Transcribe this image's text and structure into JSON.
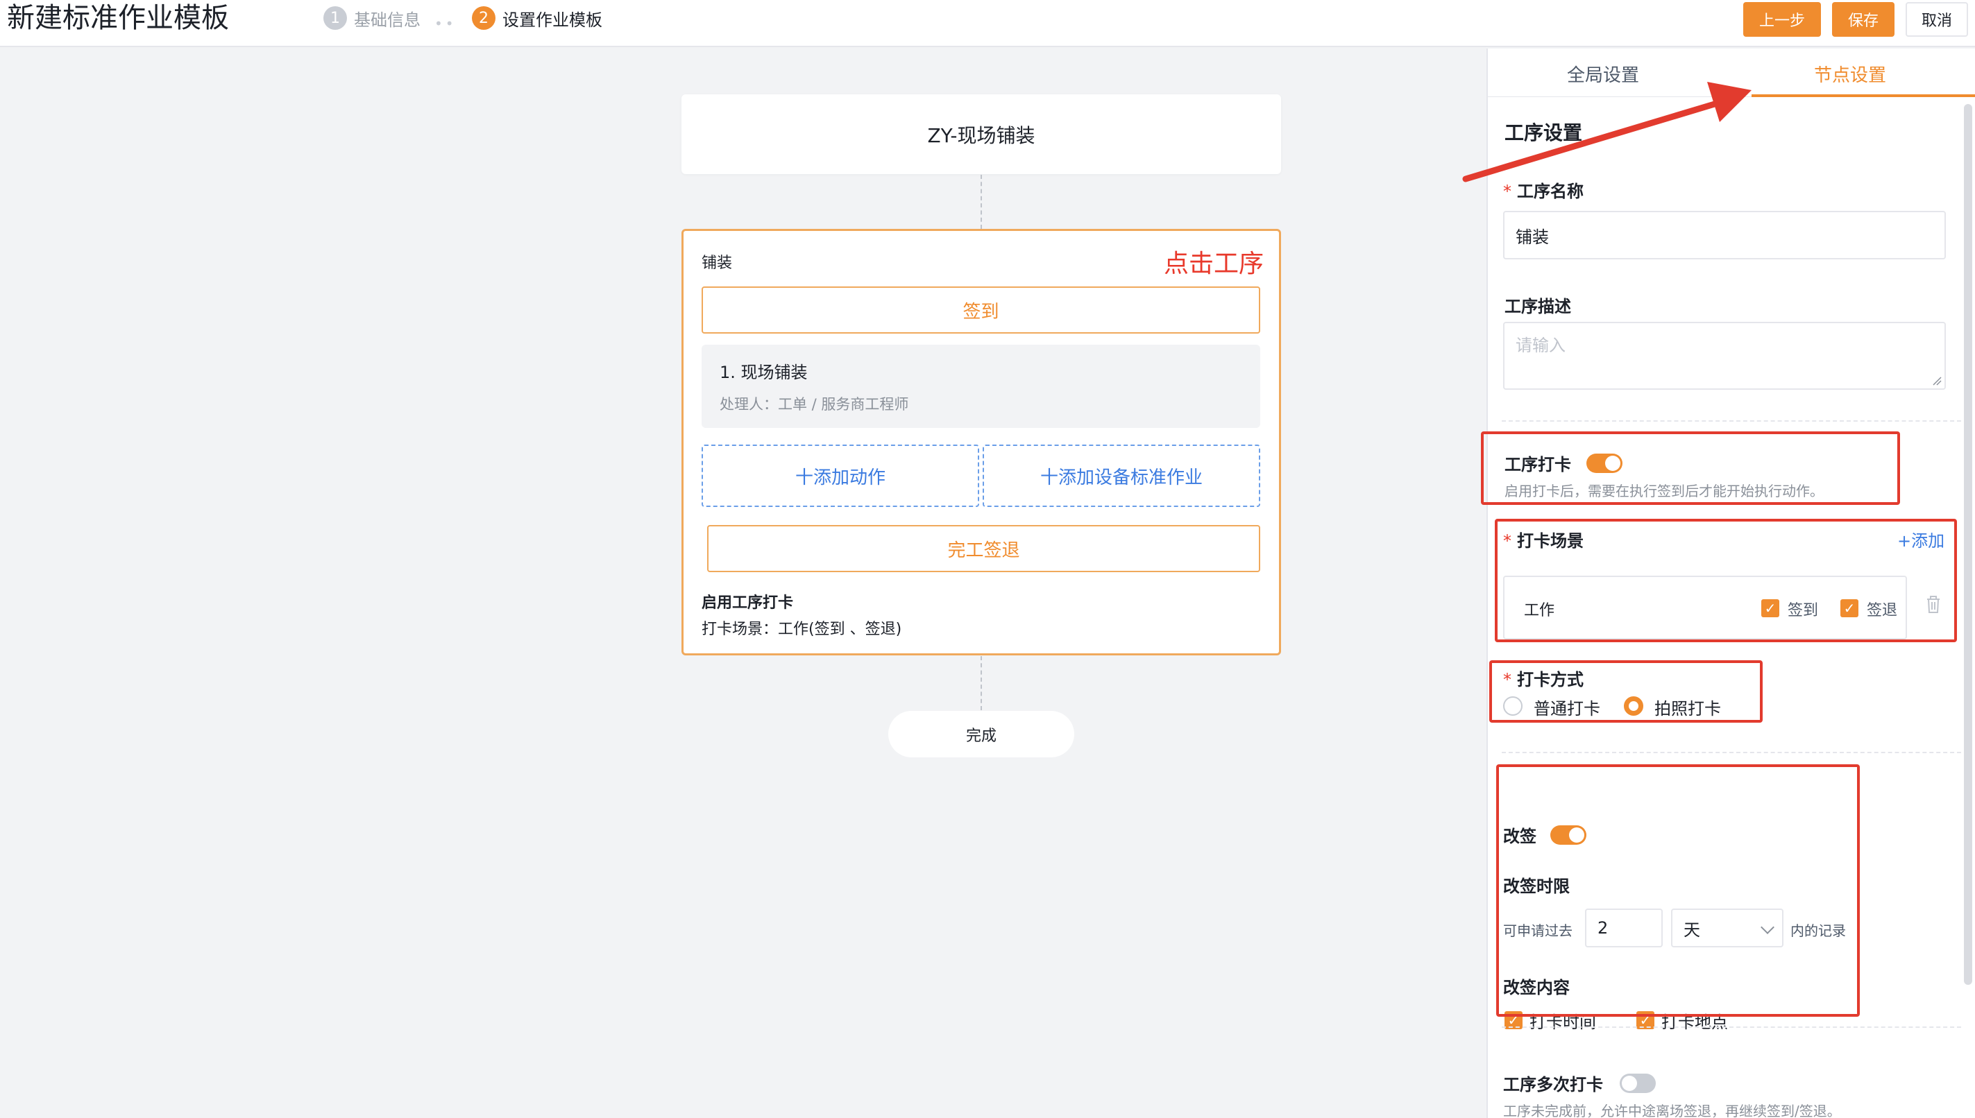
{
  "header": {
    "title": "新建标准作业模板",
    "steps": [
      {
        "num": "1",
        "label": "基础信息"
      },
      {
        "num": "2",
        "label": "设置作业模板"
      }
    ],
    "buttons": {
      "prev": "上一步",
      "save": "保存",
      "cancel": "取消"
    }
  },
  "canvas": {
    "top_node": "ZY-现场铺装",
    "process_node": {
      "label": "铺装",
      "hint": "点击工序",
      "checkin_button": "签到",
      "action": {
        "title": "1. 现场铺装",
        "handler": "处理人：工单 / 服务商工程师"
      },
      "add_action": "十添加动作",
      "add_device": "十添加设备标准作业",
      "checkout_button": "完工签退",
      "footer_title": "启用工序打卡",
      "footer_scene": "打卡场景：工作(签到 、签退)"
    },
    "end_node": "完成"
  },
  "panel": {
    "tabs": {
      "global": "全局设置",
      "node": "节点设置"
    },
    "section_title": "工序设置",
    "name_field": {
      "label": "工序名称",
      "value": "铺装"
    },
    "desc_field": {
      "label": "工序描述",
      "placeholder": "请输入"
    },
    "process_checkin": {
      "label": "工序打卡",
      "enabled": true,
      "hint": "启用打卡后，需要在执行签到后才能开始执行动作。"
    },
    "checkin_scene": {
      "label": "打卡场景",
      "add": "+添加",
      "row": {
        "name": "工作",
        "checkin": "签到",
        "checkout": "签退"
      }
    },
    "checkin_method": {
      "label": "打卡方式",
      "options": [
        "普通打卡",
        "拍照打卡"
      ],
      "selected": "拍照打卡"
    },
    "resign": {
      "label": "改签",
      "enabled": true,
      "limit_label": "改签时限",
      "limit_prefix": "可申请过去",
      "limit_value": "2",
      "limit_unit": "天",
      "limit_suffix": "内的记录",
      "content_label": "改签内容",
      "content_options": [
        "打卡时间",
        "打卡地点"
      ]
    },
    "multi_checkin": {
      "label": "工序多次打卡",
      "enabled": false,
      "hint": "工序未完成前，允许中途离场签退，再继续签到/签退。"
    }
  },
  "colors": {
    "accent": "#f08c2e",
    "annotation_red": "#e23b2e",
    "link_blue": "#3b7be0"
  }
}
